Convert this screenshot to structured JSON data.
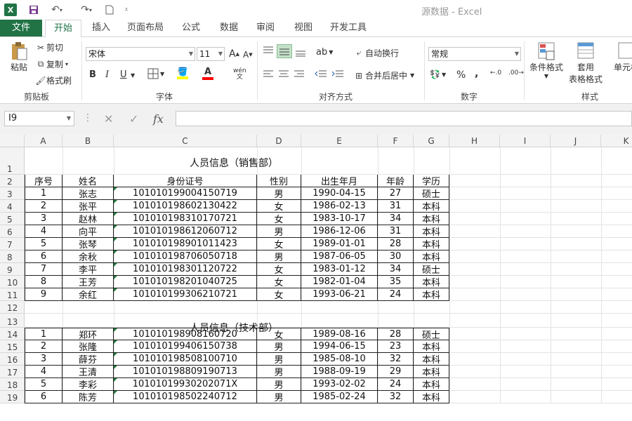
{
  "window": {
    "title": "源数据 - Excel",
    "app_icon": "X"
  },
  "quick_access": {
    "save": "save-icon",
    "undo": "undo-icon",
    "redo": "redo-icon",
    "new": "new-doc-icon"
  },
  "tabs": [
    "文件",
    "开始",
    "插入",
    "页面布局",
    "公式",
    "数据",
    "审阅",
    "视图",
    "开发工具"
  ],
  "ribbon": {
    "clipboard": {
      "paste": "粘贴",
      "cut": "剪切",
      "copy": "复制",
      "format_painter": "格式刷",
      "group": "剪贴板"
    },
    "font": {
      "name": "宋体",
      "size": "11",
      "group": "字体",
      "bold": "B",
      "italic": "I",
      "underline": "U",
      "grow": "A",
      "shrink": "A",
      "phonetic": "wén"
    },
    "alignment": {
      "wrap": "自动换行",
      "merge": "合并后居中",
      "group": "对齐方式"
    },
    "number": {
      "format": "常规",
      "percent": "%",
      "comma": ",",
      "group": "数字"
    },
    "styles": {
      "cond_format": "条件格式",
      "table_format_1": "套用",
      "table_format_2": "表格格式",
      "cell_styles": "单元格",
      "group": "样式"
    }
  },
  "formula_bar": {
    "name_box": "I9",
    "cancel": "✕",
    "enter": "✓",
    "fx": "fx",
    "value": ""
  },
  "columns": [
    "A",
    "B",
    "C",
    "D",
    "E",
    "F",
    "G",
    "H",
    "I",
    "J",
    "K"
  ],
  "row_numbers": [
    "1",
    "2",
    "3",
    "4",
    "5",
    "6",
    "7",
    "8",
    "9",
    "10",
    "11",
    "12",
    "13",
    "14",
    "15",
    "16",
    "17",
    "18",
    "19"
  ],
  "sales": {
    "title": "人员信息（销售部）",
    "headers": [
      "序号",
      "姓名",
      "身份证号",
      "性别",
      "出生年月",
      "年龄",
      "学历"
    ],
    "rows": [
      [
        "1",
        "张志",
        "101010199004150719",
        "男",
        "1990-04-15",
        "27",
        "硕士"
      ],
      [
        "2",
        "张平",
        "101010198602130422",
        "女",
        "1986-02-13",
        "31",
        "本科"
      ],
      [
        "3",
        "赵林",
        "101010198310170721",
        "女",
        "1983-10-17",
        "34",
        "本科"
      ],
      [
        "4",
        "向平",
        "101010198612060712",
        "男",
        "1986-12-06",
        "31",
        "本科"
      ],
      [
        "5",
        "张琴",
        "101010198901011423",
        "女",
        "1989-01-01",
        "28",
        "本科"
      ],
      [
        "6",
        "余秋",
        "101010198706050718",
        "男",
        "1987-06-05",
        "30",
        "本科"
      ],
      [
        "7",
        "李平",
        "101010198301120722",
        "女",
        "1983-01-12",
        "34",
        "硕士"
      ],
      [
        "8",
        "王芳",
        "101010198201040725",
        "女",
        "1982-01-04",
        "35",
        "本科"
      ],
      [
        "9",
        "余红",
        "101010199306210721",
        "女",
        "1993-06-21",
        "24",
        "本科"
      ]
    ]
  },
  "tech": {
    "title": "人员信息（技术部）",
    "rows": [
      [
        "1",
        "郑环",
        "101010198908160720",
        "女",
        "1989-08-16",
        "28",
        "硕士"
      ],
      [
        "2",
        "张隆",
        "101010199406150738",
        "男",
        "1994-06-15",
        "23",
        "本科"
      ],
      [
        "3",
        "薛芬",
        "101010198508100710",
        "男",
        "1985-08-10",
        "32",
        "本科"
      ],
      [
        "4",
        "王清",
        "101010198809190713",
        "男",
        "1988-09-19",
        "29",
        "本科"
      ],
      [
        "5",
        "李彩",
        "10101019930202071X",
        "男",
        "1993-02-02",
        "24",
        "本科"
      ],
      [
        "6",
        "陈芳",
        "101010198502240712",
        "男",
        "1985-02-24",
        "32",
        "本科"
      ]
    ]
  },
  "colors": {
    "accent": "#217346",
    "error_triangle": "#1e7b3c"
  }
}
